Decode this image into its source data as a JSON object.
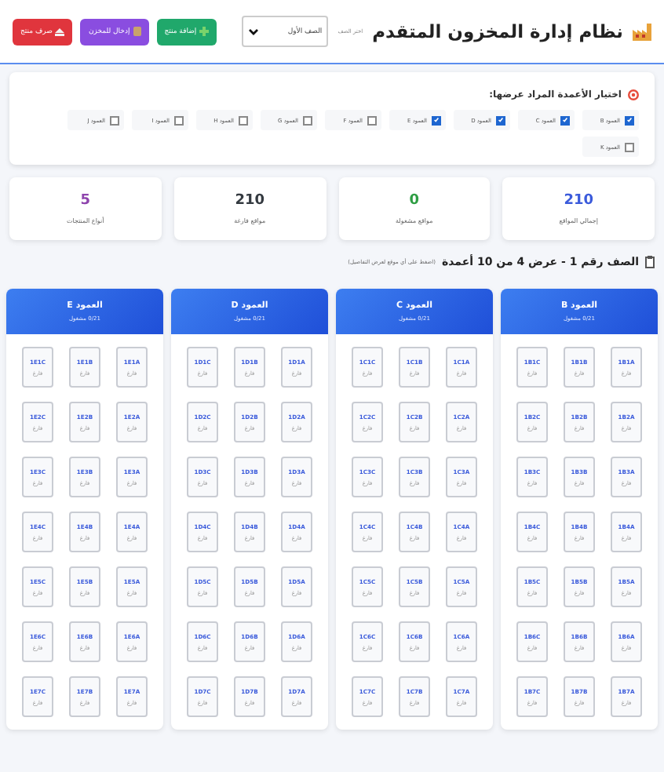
{
  "header": {
    "title": "نظام إدارة المخزون المتقدم",
    "row_select": {
      "label": "اختر الصف",
      "value": "الصف الأول"
    },
    "buttons": [
      {
        "label": "إضافة منتج",
        "kind": "add"
      },
      {
        "label": "إدخال للمخزن",
        "kind": "stock-in"
      },
      {
        "label": "صرف منتج",
        "kind": "dispense"
      }
    ]
  },
  "column_picker": {
    "title": "اختيار الأعمدة المراد عرضها:",
    "options": [
      {
        "label": "العمود B",
        "checked": true
      },
      {
        "label": "العمود C",
        "checked": true
      },
      {
        "label": "العمود D",
        "checked": true
      },
      {
        "label": "العمود E",
        "checked": true
      },
      {
        "label": "العمود F",
        "checked": false
      },
      {
        "label": "العمود G",
        "checked": false
      },
      {
        "label": "العمود H",
        "checked": false
      },
      {
        "label": "العمود I",
        "checked": false
      },
      {
        "label": "العمود J",
        "checked": false
      },
      {
        "label": "العمود K",
        "checked": false
      }
    ]
  },
  "stats": [
    {
      "value": "210",
      "label": "إجمالي المواقع",
      "color": "#3b5bdb"
    },
    {
      "value": "0",
      "label": "مواقع مشغولة",
      "color": "#2f9e44"
    },
    {
      "value": "210",
      "label": "مواقع فارغة",
      "color": "#343a40"
    },
    {
      "value": "5",
      "label": "أنواع المنتجات",
      "color": "#8e44ad"
    }
  ],
  "section": {
    "title": "الصف رقم 1 - عرض 4 من 10 أعمدة",
    "hint": "(اضغط على أي موقع لعرض التفاصيل)"
  },
  "columns": [
    {
      "title": "العمود B",
      "occupancy": "0/21 مشغول",
      "cells": [
        {
          "code": "1B1A",
          "status": "فارغ"
        },
        {
          "code": "1B1B",
          "status": "فارغ"
        },
        {
          "code": "1B1C",
          "status": "فارغ"
        },
        {
          "code": "1B2A",
          "status": "فارغ"
        },
        {
          "code": "1B2B",
          "status": "فارغ"
        },
        {
          "code": "1B2C",
          "status": "فارغ"
        },
        {
          "code": "1B3A",
          "status": "فارغ"
        },
        {
          "code": "1B3B",
          "status": "فارغ"
        },
        {
          "code": "1B3C",
          "status": "فارغ"
        },
        {
          "code": "1B4A",
          "status": "فارغ"
        },
        {
          "code": "1B4B",
          "status": "فارغ"
        },
        {
          "code": "1B4C",
          "status": "فارغ"
        },
        {
          "code": "1B5A",
          "status": "فارغ"
        },
        {
          "code": "1B5B",
          "status": "فارغ"
        },
        {
          "code": "1B5C",
          "status": "فارغ"
        },
        {
          "code": "1B6A",
          "status": "فارغ"
        },
        {
          "code": "1B6B",
          "status": "فارغ"
        },
        {
          "code": "1B6C",
          "status": "فارغ"
        },
        {
          "code": "1B7A",
          "status": "فارغ"
        },
        {
          "code": "1B7B",
          "status": "فارغ"
        },
        {
          "code": "1B7C",
          "status": "فارغ"
        }
      ]
    },
    {
      "title": "العمود C",
      "occupancy": "0/21 مشغول",
      "cells": [
        {
          "code": "1C1A",
          "status": "فارغ"
        },
        {
          "code": "1C1B",
          "status": "فارغ"
        },
        {
          "code": "1C1C",
          "status": "فارغ"
        },
        {
          "code": "1C2A",
          "status": "فارغ"
        },
        {
          "code": "1C2B",
          "status": "فارغ"
        },
        {
          "code": "1C2C",
          "status": "فارغ"
        },
        {
          "code": "1C3A",
          "status": "فارغ"
        },
        {
          "code": "1C3B",
          "status": "فارغ"
        },
        {
          "code": "1C3C",
          "status": "فارغ"
        },
        {
          "code": "1C4A",
          "status": "فارغ"
        },
        {
          "code": "1C4B",
          "status": "فارغ"
        },
        {
          "code": "1C4C",
          "status": "فارغ"
        },
        {
          "code": "1C5A",
          "status": "فارغ"
        },
        {
          "code": "1C5B",
          "status": "فارغ"
        },
        {
          "code": "1C5C",
          "status": "فارغ"
        },
        {
          "code": "1C6A",
          "status": "فارغ"
        },
        {
          "code": "1C6B",
          "status": "فارغ"
        },
        {
          "code": "1C6C",
          "status": "فارغ"
        },
        {
          "code": "1C7A",
          "status": "فارغ"
        },
        {
          "code": "1C7B",
          "status": "فارغ"
        },
        {
          "code": "1C7C",
          "status": "فارغ"
        }
      ]
    },
    {
      "title": "العمود D",
      "occupancy": "0/21 مشغول",
      "cells": [
        {
          "code": "1D1A",
          "status": "فارغ"
        },
        {
          "code": "1D1B",
          "status": "فارغ"
        },
        {
          "code": "1D1C",
          "status": "فارغ"
        },
        {
          "code": "1D2A",
          "status": "فارغ"
        },
        {
          "code": "1D2B",
          "status": "فارغ"
        },
        {
          "code": "1D2C",
          "status": "فارغ"
        },
        {
          "code": "1D3A",
          "status": "فارغ"
        },
        {
          "code": "1D3B",
          "status": "فارغ"
        },
        {
          "code": "1D3C",
          "status": "فارغ"
        },
        {
          "code": "1D4A",
          "status": "فارغ"
        },
        {
          "code": "1D4B",
          "status": "فارغ"
        },
        {
          "code": "1D4C",
          "status": "فارغ"
        },
        {
          "code": "1D5A",
          "status": "فارغ"
        },
        {
          "code": "1D5B",
          "status": "فارغ"
        },
        {
          "code": "1D5C",
          "status": "فارغ"
        },
        {
          "code": "1D6A",
          "status": "فارغ"
        },
        {
          "code": "1D6B",
          "status": "فارغ"
        },
        {
          "code": "1D6C",
          "status": "فارغ"
        },
        {
          "code": "1D7A",
          "status": "فارغ"
        },
        {
          "code": "1D7B",
          "status": "فارغ"
        },
        {
          "code": "1D7C",
          "status": "فارغ"
        }
      ]
    },
    {
      "title": "العمود E",
      "occupancy": "0/21 مشغول",
      "cells": [
        {
          "code": "1E1A",
          "status": "فارغ"
        },
        {
          "code": "1E1B",
          "status": "فارغ"
        },
        {
          "code": "1E1C",
          "status": "فارغ"
        },
        {
          "code": "1E2A",
          "status": "فارغ"
        },
        {
          "code": "1E2B",
          "status": "فارغ"
        },
        {
          "code": "1E2C",
          "status": "فارغ"
        },
        {
          "code": "1E3A",
          "status": "فارغ"
        },
        {
          "code": "1E3B",
          "status": "فارغ"
        },
        {
          "code": "1E3C",
          "status": "فارغ"
        },
        {
          "code": "1E4A",
          "status": "فارغ"
        },
        {
          "code": "1E4B",
          "status": "فارغ"
        },
        {
          "code": "1E4C",
          "status": "فارغ"
        },
        {
          "code": "1E5A",
          "status": "فارغ"
        },
        {
          "code": "1E5B",
          "status": "فارغ"
        },
        {
          "code": "1E5C",
          "status": "فارغ"
        },
        {
          "code": "1E6A",
          "status": "فارغ"
        },
        {
          "code": "1E6B",
          "status": "فارغ"
        },
        {
          "code": "1E6C",
          "status": "فارغ"
        },
        {
          "code": "1E7A",
          "status": "فارغ"
        },
        {
          "code": "1E7B",
          "status": "فارغ"
        },
        {
          "code": "1E7C",
          "status": "فارغ"
        }
      ]
    }
  ]
}
